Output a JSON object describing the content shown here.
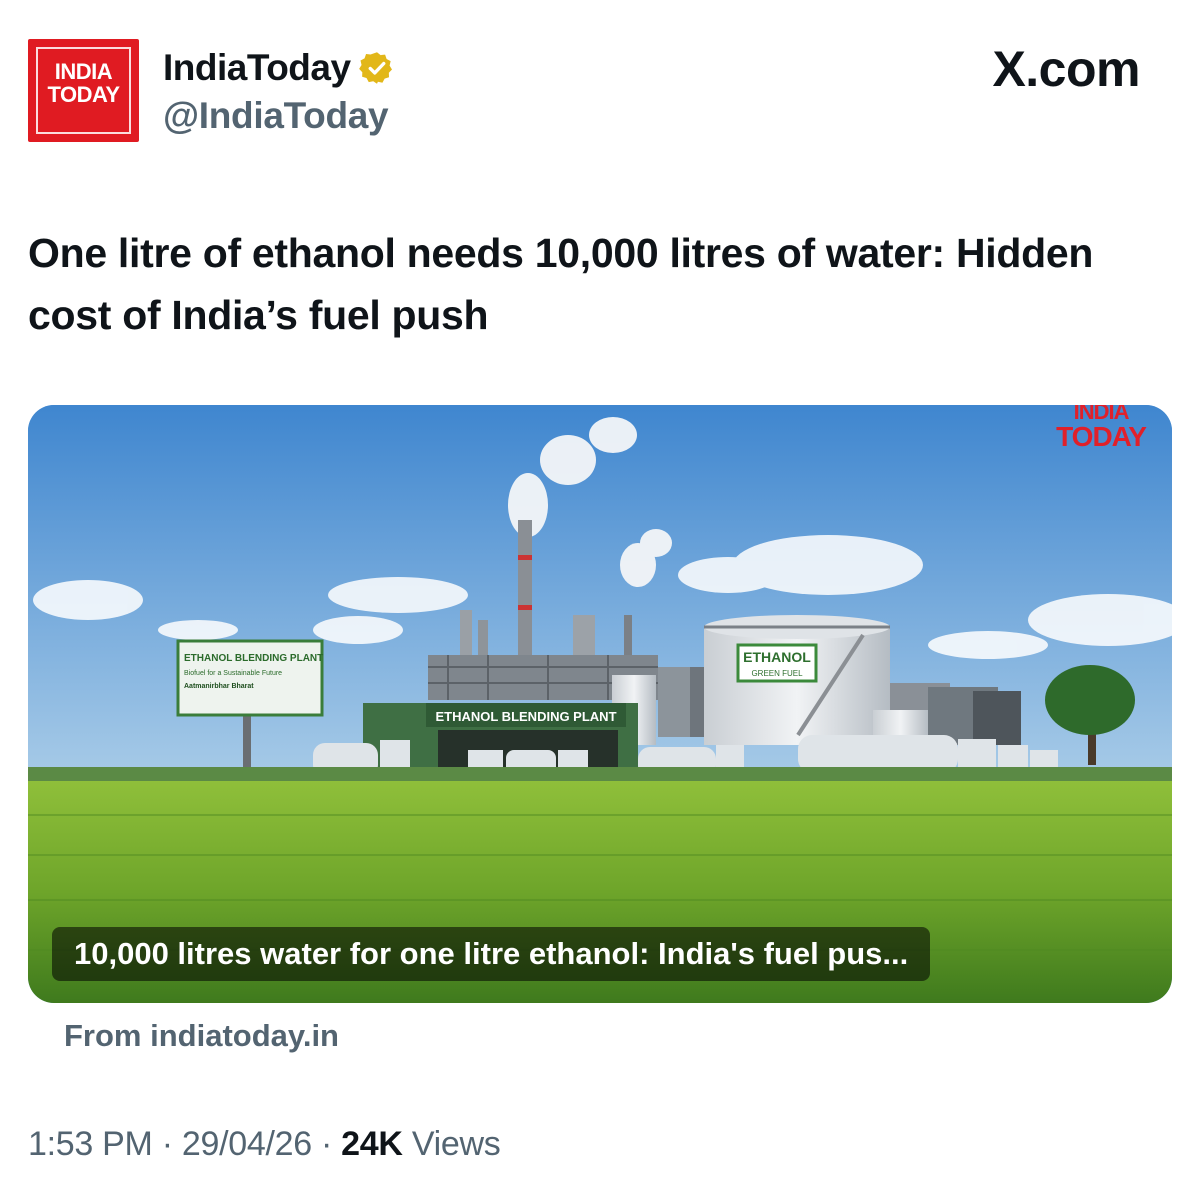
{
  "account": {
    "logo_line1": "INDIA",
    "logo_line2": "TODAY",
    "name": "IndiaToday",
    "handle": "@IndiaToday",
    "verified_badge": "verified-gold-icon"
  },
  "source_label": "X.com",
  "post": {
    "headline": "One litre of ethanol needs 10,000 litres of water: Hidden cost of India’s fuel push"
  },
  "card": {
    "watermark_line1": "INDIA",
    "watermark_line2": "TODAY",
    "billboard_title": "ETHANOL BLENDING PLANT",
    "billboard_sub": "Biofuel for a Sustainable Future",
    "billboard_tag": "Aatmanirbhar Bharat",
    "shed_sign": "ETHANOL BLENDING PLANT",
    "tank_label_1": "ETHANOL",
    "tank_label_2": "GREEN FUEL",
    "caption": "10,000 litres water for one litre ethanol: India's fuel pus...",
    "from": "From indiatoday.in"
  },
  "meta": {
    "time": "1:53 PM",
    "date": "29/04/26",
    "views_count": "24K",
    "views_label": "Views",
    "sep": "·"
  },
  "colors": {
    "brand_red": "#e01b22",
    "verified_gold": "#e2b719",
    "secondary_text": "#536471"
  }
}
